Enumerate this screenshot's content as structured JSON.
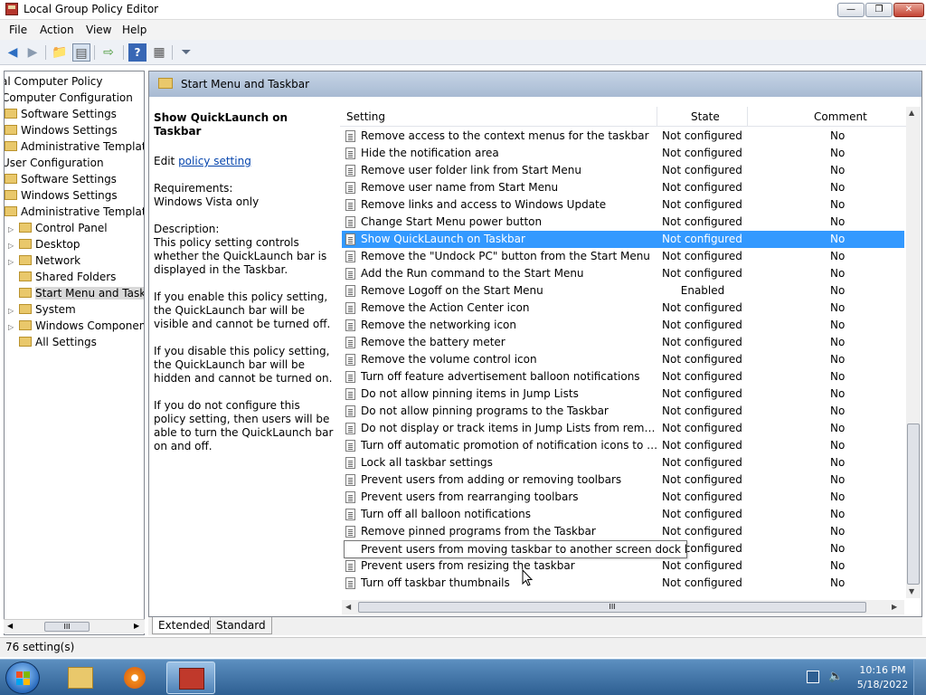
{
  "window": {
    "title": "Local Group Policy Editor"
  },
  "menu": [
    "File",
    "Action",
    "View",
    "Help"
  ],
  "tree": {
    "items": [
      {
        "label": "al Computer Policy",
        "kind": "doc"
      },
      {
        "label": "Computer Configuration",
        "kind": "none"
      },
      {
        "label": "Software Settings",
        "kind": "folder"
      },
      {
        "label": "Windows Settings",
        "kind": "folder"
      },
      {
        "label": "Administrative Templates",
        "kind": "folder"
      },
      {
        "label": "User Configuration",
        "kind": "none"
      },
      {
        "label": "Software Settings",
        "kind": "folder"
      },
      {
        "label": "Windows Settings",
        "kind": "folder"
      },
      {
        "label": "Administrative Templates",
        "kind": "folder"
      },
      {
        "label": "Control Panel",
        "kind": "folder"
      },
      {
        "label": "Desktop",
        "kind": "folder"
      },
      {
        "label": "Network",
        "kind": "folder"
      },
      {
        "label": "Shared Folders",
        "kind": "folder"
      },
      {
        "label": "Start Menu and Taskbar",
        "kind": "folder",
        "selected": true
      },
      {
        "label": "System",
        "kind": "folder"
      },
      {
        "label": "Windows Components",
        "kind": "folder"
      },
      {
        "label": "All Settings",
        "kind": "folder"
      }
    ],
    "hscroll_label": "III"
  },
  "pane": {
    "header": "Start Menu and Taskbar",
    "description": {
      "policy_name": "Show QuickLaunch on Taskbar",
      "edit_prefix": "Edit ",
      "edit_link": "policy setting",
      "requirements_label": "Requirements:",
      "requirements_value": "Windows Vista only",
      "description_label": "Description:",
      "paragraphs": [
        "This policy setting controls whether the QuickLaunch bar is displayed in the Taskbar.",
        "If you enable this policy setting, the QuickLaunch bar will be visible and cannot be turned off.",
        "If you disable this policy setting, the QuickLaunch bar will be hidden and cannot be turned on.",
        "If you do not configure this policy setting, then users will be able to turn the QuickLaunch bar on and off."
      ]
    },
    "columns": {
      "setting": "Setting",
      "state": "State",
      "comment": "Comment"
    },
    "rows": [
      {
        "name": "Remove access to the context menus for the taskbar",
        "state": "Not configured",
        "comment": "No"
      },
      {
        "name": "Hide the notification area",
        "state": "Not configured",
        "comment": "No"
      },
      {
        "name": "Remove user folder link from Start Menu",
        "state": "Not configured",
        "comment": "No"
      },
      {
        "name": "Remove user name from Start Menu",
        "state": "Not configured",
        "comment": "No"
      },
      {
        "name": "Remove links and access to Windows Update",
        "state": "Not configured",
        "comment": "No"
      },
      {
        "name": "Change Start Menu power button",
        "state": "Not configured",
        "comment": "No"
      },
      {
        "name": "Show QuickLaunch on Taskbar",
        "state": "Not configured",
        "comment": "No",
        "selected": true
      },
      {
        "name": "Remove the \"Undock PC\" button from the Start Menu",
        "state": "Not configured",
        "comment": "No"
      },
      {
        "name": "Add the Run command to the Start Menu",
        "state": "Not configured",
        "comment": "No"
      },
      {
        "name": "Remove Logoff on the Start Menu",
        "state": "Enabled",
        "comment": "No"
      },
      {
        "name": "Remove the Action Center icon",
        "state": "Not configured",
        "comment": "No"
      },
      {
        "name": "Remove the networking icon",
        "state": "Not configured",
        "comment": "No"
      },
      {
        "name": "Remove the battery meter",
        "state": "Not configured",
        "comment": "No"
      },
      {
        "name": "Remove the volume control icon",
        "state": "Not configured",
        "comment": "No"
      },
      {
        "name": "Turn off feature advertisement balloon notifications",
        "state": "Not configured",
        "comment": "No"
      },
      {
        "name": "Do not allow pinning items in Jump Lists",
        "state": "Not configured",
        "comment": "No"
      },
      {
        "name": "Do not allow pinning programs to the Taskbar",
        "state": "Not configured",
        "comment": "No"
      },
      {
        "name": "Do not display or track items in Jump Lists from remote loca...",
        "state": "Not configured",
        "comment": "No"
      },
      {
        "name": "Turn off automatic promotion of notification icons to the ta...",
        "state": "Not configured",
        "comment": "No"
      },
      {
        "name": "Lock all taskbar settings",
        "state": "Not configured",
        "comment": "No"
      },
      {
        "name": "Prevent users from adding or removing toolbars",
        "state": "Not configured",
        "comment": "No"
      },
      {
        "name": "Prevent users from rearranging toolbars",
        "state": "Not configured",
        "comment": "No"
      },
      {
        "name": "Turn off all balloon notifications",
        "state": "Not configured",
        "comment": "No"
      },
      {
        "name": "Remove pinned programs from the Taskbar",
        "state": "Not configured",
        "comment": "No"
      },
      {
        "name": "Prevent users from moving taskbar to another screen dock l...",
        "state": "Not configured",
        "comment": "No"
      },
      {
        "name": "Prevent users from resizing the taskbar",
        "state": "Not configured",
        "comment": "No"
      },
      {
        "name": "Turn off taskbar thumbnails",
        "state": "Not configured",
        "comment": "No"
      }
    ],
    "tooltip": "Prevent users from moving taskbar to another screen dock location",
    "hscroll_label": "III"
  },
  "tabs": [
    "Extended",
    "Standard"
  ],
  "status": "76 setting(s)",
  "taskbar": {
    "time": "10:16 PM",
    "date": "5/18/2022"
  }
}
